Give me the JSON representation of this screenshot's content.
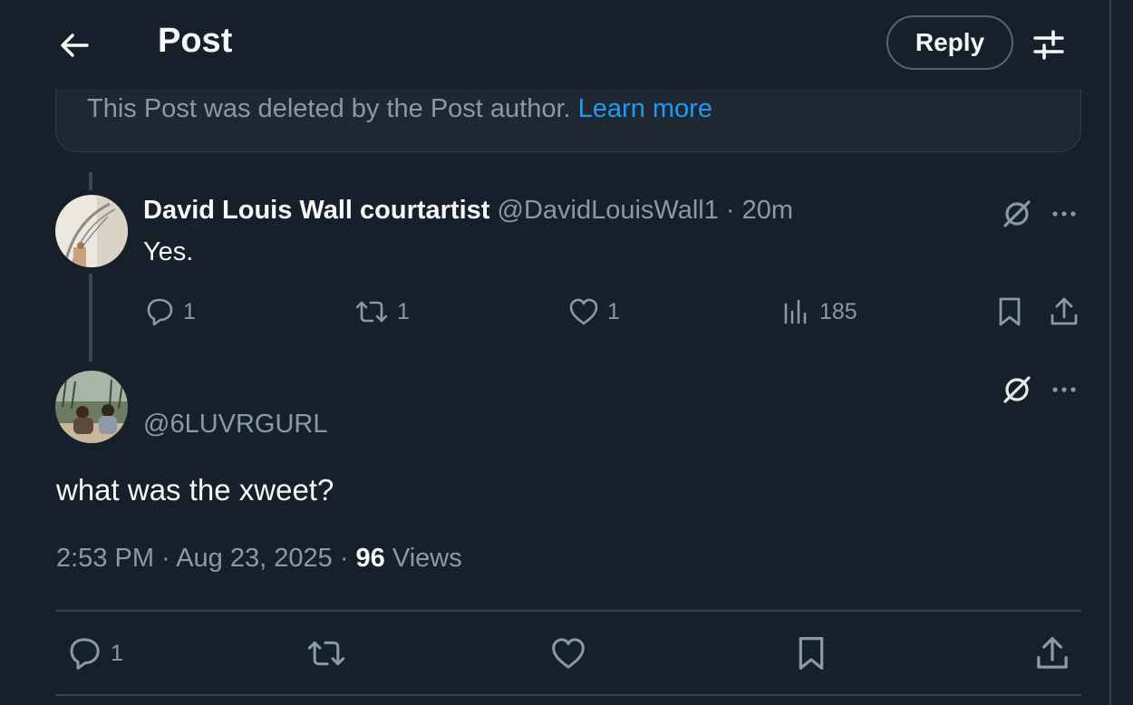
{
  "header": {
    "title": "Post",
    "reply_label": "Reply"
  },
  "deleted_notice": {
    "text": "This Post was deleted by the Post author.",
    "link": "Learn more"
  },
  "reply": {
    "author_name": "David Louis Wall courtartist",
    "author_handle": "@DavidLouisWall1",
    "separator": "·",
    "time": "20m",
    "text": "Yes.",
    "stats": {
      "replies": "1",
      "reposts": "1",
      "likes": "1",
      "views": "185"
    }
  },
  "main_post": {
    "handle": "@6LUVRGURL",
    "text": "what was the xweet?",
    "time": "2:53 PM",
    "date": "Aug 23, 2025",
    "separator": "·",
    "views_count": "96",
    "views_label": "Views",
    "stats": {
      "replies": "1"
    }
  },
  "colors": {
    "background": "#15202b",
    "accent": "#1d9bf0",
    "muted_text": "#8b98a5",
    "primary_text": "#f7f9f9"
  }
}
